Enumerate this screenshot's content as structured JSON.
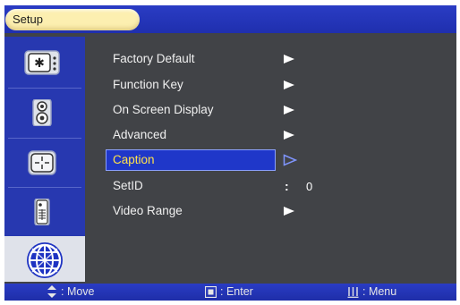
{
  "header": {
    "title": "Setup"
  },
  "sidebar": {
    "items": [
      {
        "icon": "picture-icon",
        "active": false
      },
      {
        "icon": "speaker-icon",
        "active": false
      },
      {
        "icon": "crosshair-icon",
        "active": false
      },
      {
        "icon": "remote-control-icon",
        "active": false
      },
      {
        "icon": "globe-icon",
        "active": true
      }
    ]
  },
  "menu": {
    "items": [
      {
        "label": "Factory Default",
        "indicator": "submenu-arrow"
      },
      {
        "label": "Function Key",
        "indicator": "submenu-arrow"
      },
      {
        "label": "On Screen Display",
        "indicator": "submenu-arrow"
      },
      {
        "label": "Advanced",
        "indicator": "submenu-arrow"
      },
      {
        "label": "Caption",
        "indicator": "submenu-arrow-outline",
        "selected": true
      },
      {
        "label": "SetID",
        "indicator": "value",
        "value": "0"
      },
      {
        "label": "Video Range",
        "indicator": "submenu-arrow"
      }
    ],
    "value_separator": ":"
  },
  "footer": {
    "move": {
      "icon": "up-down-arrows-icon",
      "label": ": Move"
    },
    "enter": {
      "icon": "enter-key-icon",
      "label": ": Enter"
    },
    "menu": {
      "icon": "menu-key-icon",
      "label": ": Menu"
    }
  },
  "colors": {
    "header_bar": "#2a3cc4",
    "sidebar": "#2738b0",
    "panel": "#414347",
    "title_pill": "#fcefb0",
    "selected_text": "#ffe24a",
    "selection_bar": "#1f37c9"
  }
}
